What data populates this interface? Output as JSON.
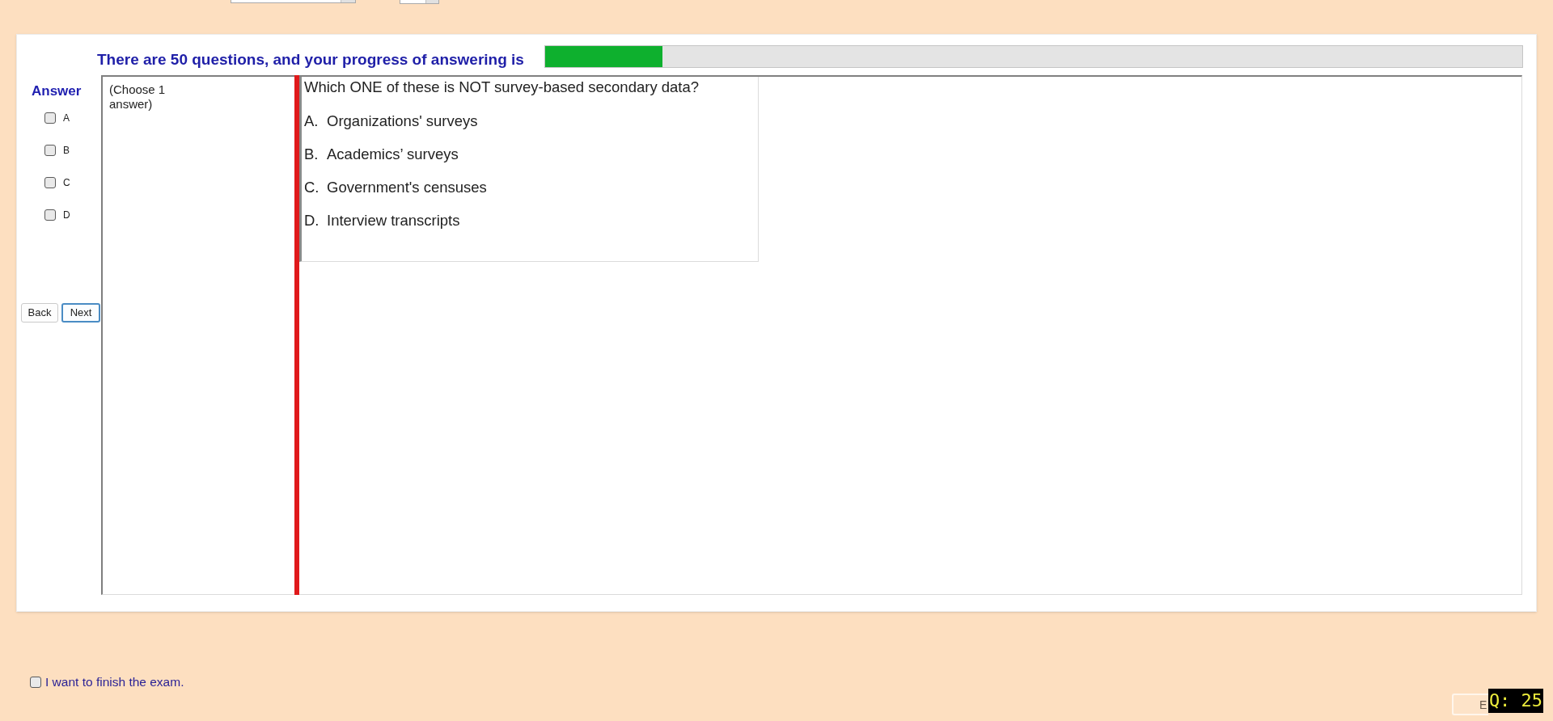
{
  "progress": {
    "text": "There are 50 questions, and your progress of answering is",
    "level": 0.12
  },
  "answer_panel": {
    "title": "Answer",
    "options": [
      {
        "label": "A",
        "checked": false
      },
      {
        "label": "B",
        "checked": false
      },
      {
        "label": "C",
        "checked": false
      },
      {
        "label": "D",
        "checked": false
      }
    ],
    "buttons": [
      {
        "label": "Back",
        "focused": false
      },
      {
        "label": "Next",
        "focused": true
      }
    ]
  },
  "instruction": "(Choose 1 answer)",
  "question": {
    "text": "Which ONE of these is NOT survey-based secondary data?",
    "options": [
      {
        "letter": "A.",
        "text": "Organizations' surveys"
      },
      {
        "letter": "B.",
        "text": "Academics’ surveys"
      },
      {
        "letter": "C.",
        "text": "Government's censuses"
      },
      {
        "letter": "D.",
        "text": "Interview transcripts"
      }
    ]
  },
  "finish": {
    "label": "I want to finish the exam.",
    "checked": false
  },
  "bottom_button": {
    "label": "E"
  },
  "question_badge": "Q: 25"
}
